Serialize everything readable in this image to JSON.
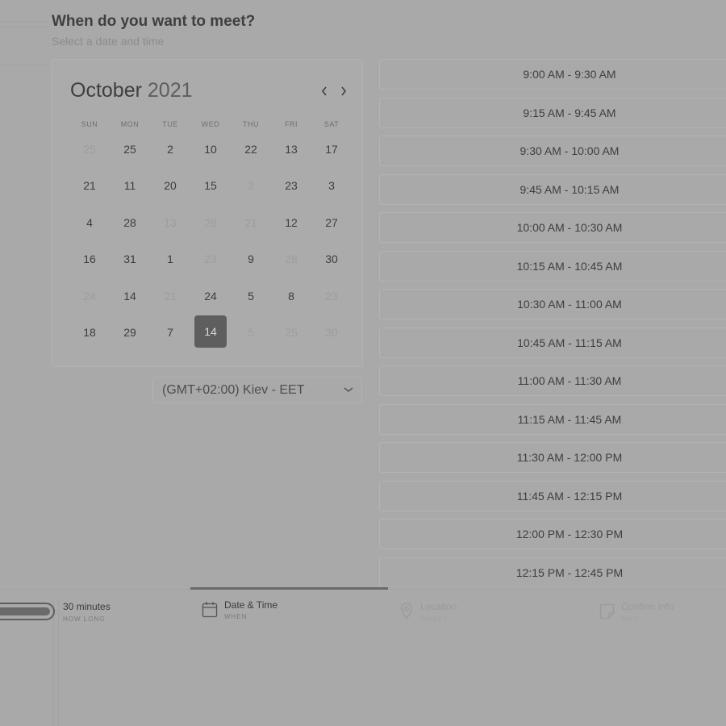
{
  "header": {
    "title": "When do you want to meet?",
    "subtitle": "Select a date and time"
  },
  "calendar": {
    "month": "October",
    "year": "2021",
    "weekdays": [
      "SUN",
      "MON",
      "TUE",
      "WED",
      "THU",
      "FRI",
      "SAT"
    ],
    "days": [
      {
        "label": "25",
        "state": "muted"
      },
      {
        "label": "25",
        "state": "normal"
      },
      {
        "label": "2",
        "state": "normal"
      },
      {
        "label": "10",
        "state": "normal"
      },
      {
        "label": "22",
        "state": "normal"
      },
      {
        "label": "13",
        "state": "normal"
      },
      {
        "label": "17",
        "state": "normal"
      },
      {
        "label": "21",
        "state": "normal"
      },
      {
        "label": "11",
        "state": "normal"
      },
      {
        "label": "20",
        "state": "normal"
      },
      {
        "label": "15",
        "state": "normal"
      },
      {
        "label": "3",
        "state": "muted"
      },
      {
        "label": "23",
        "state": "normal"
      },
      {
        "label": "3",
        "state": "normal"
      },
      {
        "label": "4",
        "state": "normal"
      },
      {
        "label": "28",
        "state": "normal"
      },
      {
        "label": "13",
        "state": "muted"
      },
      {
        "label": "28",
        "state": "muted"
      },
      {
        "label": "21",
        "state": "muted"
      },
      {
        "label": "12",
        "state": "normal"
      },
      {
        "label": "27",
        "state": "normal"
      },
      {
        "label": "16",
        "state": "normal"
      },
      {
        "label": "31",
        "state": "normal"
      },
      {
        "label": "1",
        "state": "normal"
      },
      {
        "label": "23",
        "state": "muted"
      },
      {
        "label": "9",
        "state": "normal"
      },
      {
        "label": "28",
        "state": "muted"
      },
      {
        "label": "30",
        "state": "normal"
      },
      {
        "label": "24",
        "state": "muted"
      },
      {
        "label": "14",
        "state": "normal"
      },
      {
        "label": "21",
        "state": "muted"
      },
      {
        "label": "24",
        "state": "normal"
      },
      {
        "label": "5",
        "state": "normal"
      },
      {
        "label": "8",
        "state": "normal"
      },
      {
        "label": "23",
        "state": "muted"
      },
      {
        "label": "18",
        "state": "normal"
      },
      {
        "label": "29",
        "state": "normal"
      },
      {
        "label": "7",
        "state": "normal"
      },
      {
        "label": "14",
        "state": "selected"
      },
      {
        "label": "5",
        "state": "muted"
      },
      {
        "label": "25",
        "state": "muted"
      },
      {
        "label": "30",
        "state": "muted"
      }
    ]
  },
  "timezone": {
    "value": "(GMT+02:00) Kiev - EET"
  },
  "slots": [
    "9:00 AM - 9:30 AM",
    "9:15 AM - 9:45 AM",
    "9:30 AM - 10:00 AM",
    "9:45 AM - 10:15 AM",
    "10:00 AM - 10:30 AM",
    "10:15 AM - 10:45 AM",
    "10:30 AM - 11:00 AM",
    "10:45 AM - 11:15 AM",
    "11:00 AM - 11:30 AM",
    "11:15 AM - 11:45 AM",
    "11:30 AM - 12:00 PM",
    "11:45 AM - 12:15 PM",
    "12:00 PM - 12:30 PM",
    "12:15 PM - 12:45 PM"
  ],
  "steps": [
    {
      "label": "30 minutes",
      "sub": "HOW LONG",
      "state": "done",
      "icon": "duration-pill-icon"
    },
    {
      "label": "Date & Time",
      "sub": "WHEN",
      "state": "active",
      "icon": "calendar-icon"
    },
    {
      "label": "Location",
      "sub": "WHERE",
      "state": "pending",
      "icon": "location-pin-icon"
    },
    {
      "label": "Confirm Info",
      "sub": "WHO",
      "state": "pending",
      "icon": "confirm-info-icon"
    }
  ]
}
